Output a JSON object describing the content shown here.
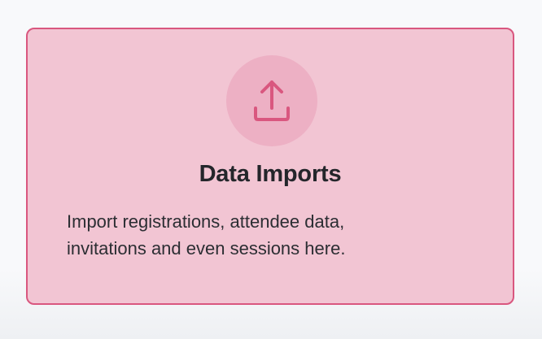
{
  "card": {
    "title": "Data Imports",
    "description_lines": [
      "Import registrations, attendee data,",
      "invitations and even sessions here."
    ],
    "icon": "upload-icon"
  },
  "colors": {
    "card_background": "#f2c5d3",
    "card_border": "#d9577f",
    "icon_circle": "#edb0c4",
    "icon_stroke": "#d9577f",
    "title_text": "#24262b",
    "body_text": "#2c2e33"
  }
}
